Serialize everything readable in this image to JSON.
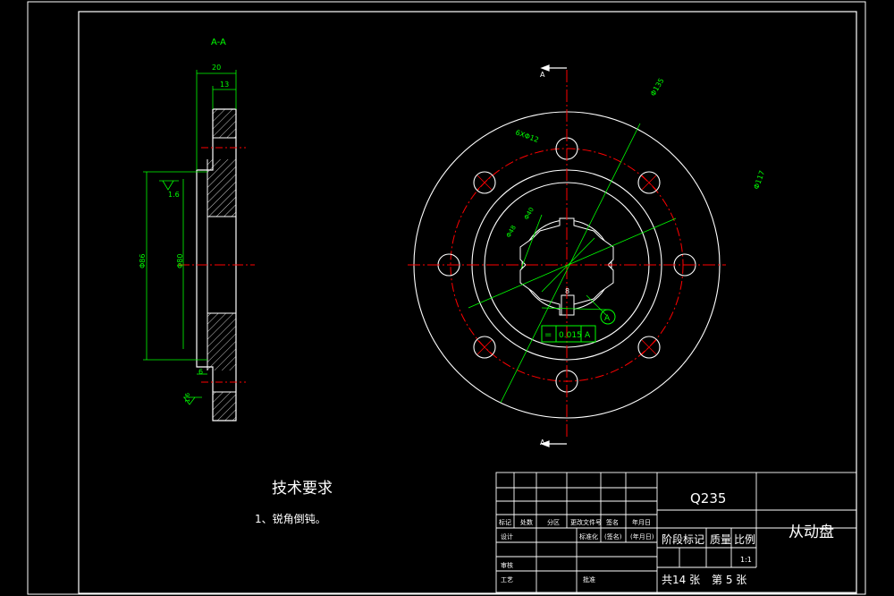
{
  "section": {
    "title": "A-A",
    "dims": {
      "overall_width": "20",
      "step_width": "13",
      "bore_dia": "Φ86",
      "bore_dia2": "Φ80",
      "chamfer": "6"
    },
    "roughness": [
      "1.6",
      "1.6"
    ]
  },
  "front": {
    "labels": {
      "section_a_top": "A",
      "section_a_bottom": "A",
      "outer_dia": "Φ135",
      "hole_pattern": "6XΦ12",
      "pcd": "Φ117",
      "spline_outer": "Φ48",
      "spline_inner": "Φ40",
      "key_width": "8",
      "datum": "A"
    },
    "tolerance": {
      "symbol": "=",
      "value": "0.015",
      "datum": "A"
    }
  },
  "notes": {
    "heading": "技术要求",
    "item1": "1、锐角倒钝。"
  },
  "title_block": {
    "material": "Q235",
    "part_name": "从动盘",
    "headers": [
      "标记",
      "处数",
      "分区",
      "更改文件号",
      "签名",
      "年月日"
    ],
    "row_design": [
      "设计",
      "",
      "",
      "标准化",
      "(签名)",
      "(年月日)"
    ],
    "review": "审核",
    "process": "工艺",
    "approve": "批准",
    "stage_label": "阶段标记",
    "mass_label": "质量",
    "scale_label": "比例",
    "scale_value": "1:1",
    "sheet_total": "共14 张",
    "sheet_no": "第 5 张"
  }
}
